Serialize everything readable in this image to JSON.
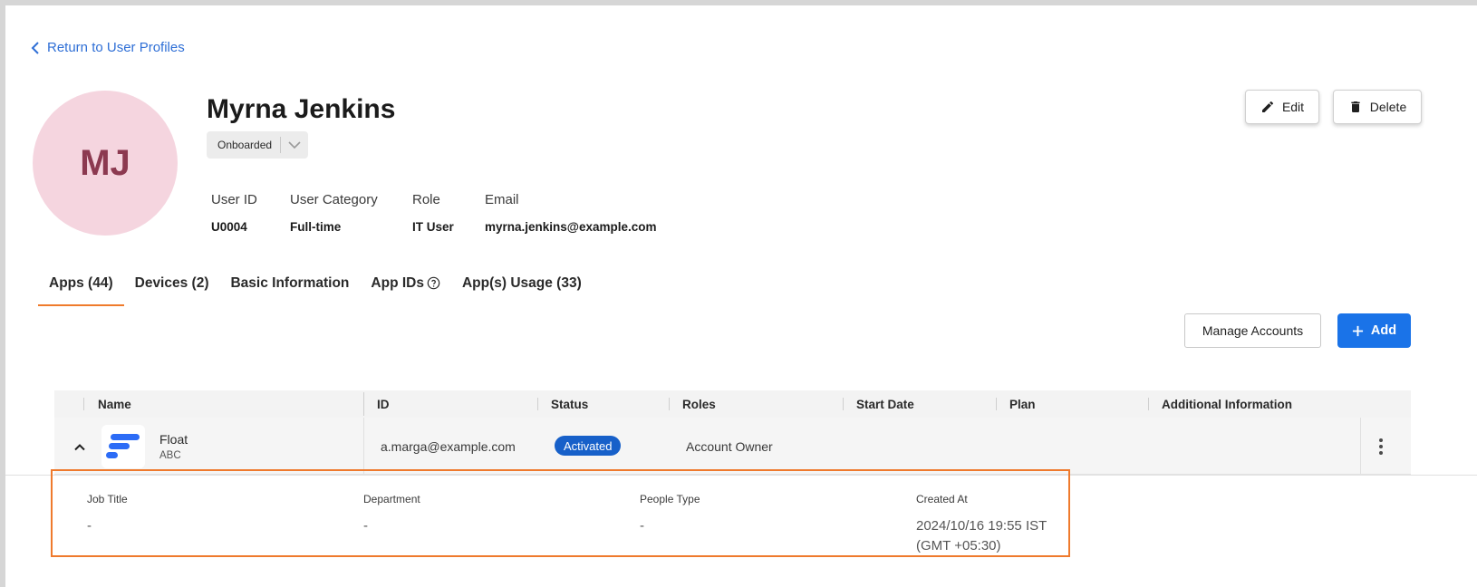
{
  "nav": {
    "back_label": "Return to User Profiles"
  },
  "user": {
    "initials": "MJ",
    "name": "Myrna Jenkins",
    "status": "Onboarded",
    "fields": {
      "user_id_label": "User ID",
      "user_id": "U0004",
      "category_label": "User Category",
      "category": "Full-time",
      "role_label": "Role",
      "role": "IT User",
      "email_label": "Email",
      "email": "myrna.jenkins@example.com"
    }
  },
  "actions": {
    "edit_label": "Edit",
    "delete_label": "Delete"
  },
  "tabs": [
    {
      "label": "Apps (44)",
      "active": true
    },
    {
      "label": "Devices (2)"
    },
    {
      "label": "Basic Information"
    },
    {
      "label": "App IDs"
    },
    {
      "label": "App(s) Usage (33)"
    }
  ],
  "toolbar": {
    "manage_label": "Manage Accounts",
    "add_label": "Add"
  },
  "table": {
    "columns": [
      "Name",
      "ID",
      "Status",
      "Roles",
      "Start Date",
      "Plan",
      "Additional Information"
    ],
    "rows": [
      {
        "app_name": "Float",
        "app_sub": "ABC",
        "id": "a.marga@example.com",
        "status": "Activated",
        "roles": "Account Owner",
        "start_date": "",
        "plan": "",
        "additional": "",
        "details": {
          "job_title_label": "Job Title",
          "job_title": "-",
          "department_label": "Department",
          "department": "-",
          "people_type_label": "People Type",
          "people_type": "-",
          "created_at_label": "Created At",
          "created_at_line1": "2024/10/16 19:55 IST",
          "created_at_line2": "(GMT +05:30)"
        }
      }
    ]
  },
  "colors": {
    "accent_blue": "#1a73e8",
    "link_blue": "#2f6fd6",
    "tab_underline": "#ef7b2b",
    "highlight_orange": "#ef7a2d",
    "avatar_bg": "#f5d5df",
    "avatar_text": "#8c3950",
    "badge_bg": "#1760c9"
  },
  "icons": [
    "chevron-left-icon",
    "chevron-down-icon",
    "pencil-icon",
    "trash-icon",
    "help-circle-icon",
    "plus-icon",
    "chevron-up-icon",
    "float-logo-icon",
    "more-vertical-icon"
  ]
}
